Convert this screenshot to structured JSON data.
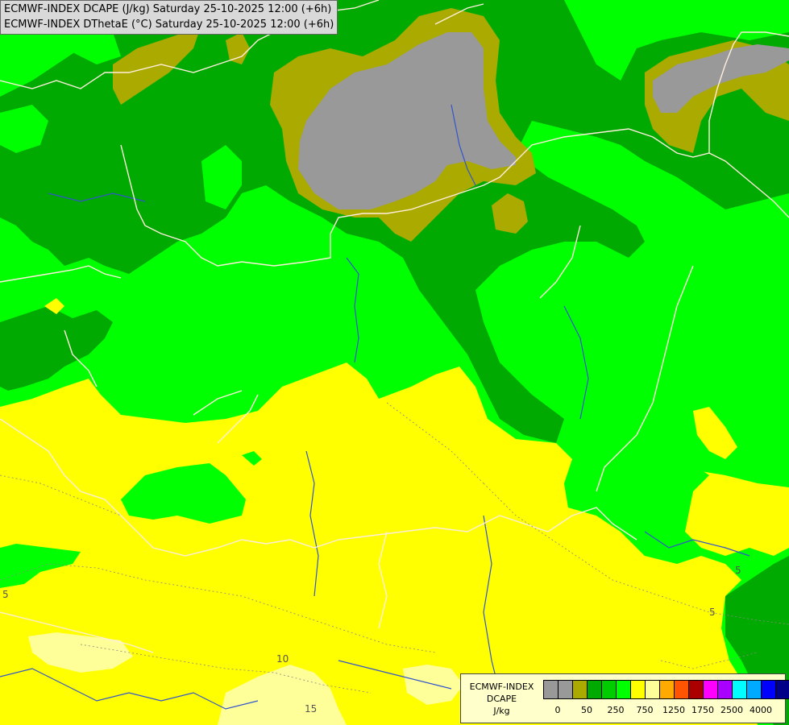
{
  "title_lines": [
    "ECMWF-INDEX DCAPE (J/kg) Saturday 25-10-2025 12:00 (+6h)",
    "ECMWF-INDEX DThetaE (°C) Saturday 25-10-2025 12:00 (+6h)"
  ],
  "legend": {
    "line1": "ECMWF-INDEX",
    "line2": "DCAPE",
    "line3": "J/kg",
    "colors": [
      "#999999",
      "#999999",
      "#aaaa00",
      "#00aa00",
      "#00cc00",
      "#00ff00",
      "#ffff00",
      "#ffff99",
      "#ffaa00",
      "#ff5500",
      "#aa0000",
      "#ff00ff",
      "#aa00ff",
      "#00ffff",
      "#00aaff",
      "#0000ff",
      "#000088"
    ],
    "ticks": [
      "0",
      "50",
      "250",
      "750",
      "1250",
      "1750",
      "2500",
      "4000"
    ]
  },
  "contour_labels": [
    "5",
    "10",
    "5",
    "5",
    "15"
  ],
  "field_colors": {
    "gray": "#999999",
    "olive": "#aaaa00",
    "dark_green": "#00aa00",
    "light_green": "#00ff00",
    "yellow": "#ffff00",
    "pale_yellow": "#ffff99",
    "border": "#ffeedd",
    "river": "#3355cc"
  }
}
